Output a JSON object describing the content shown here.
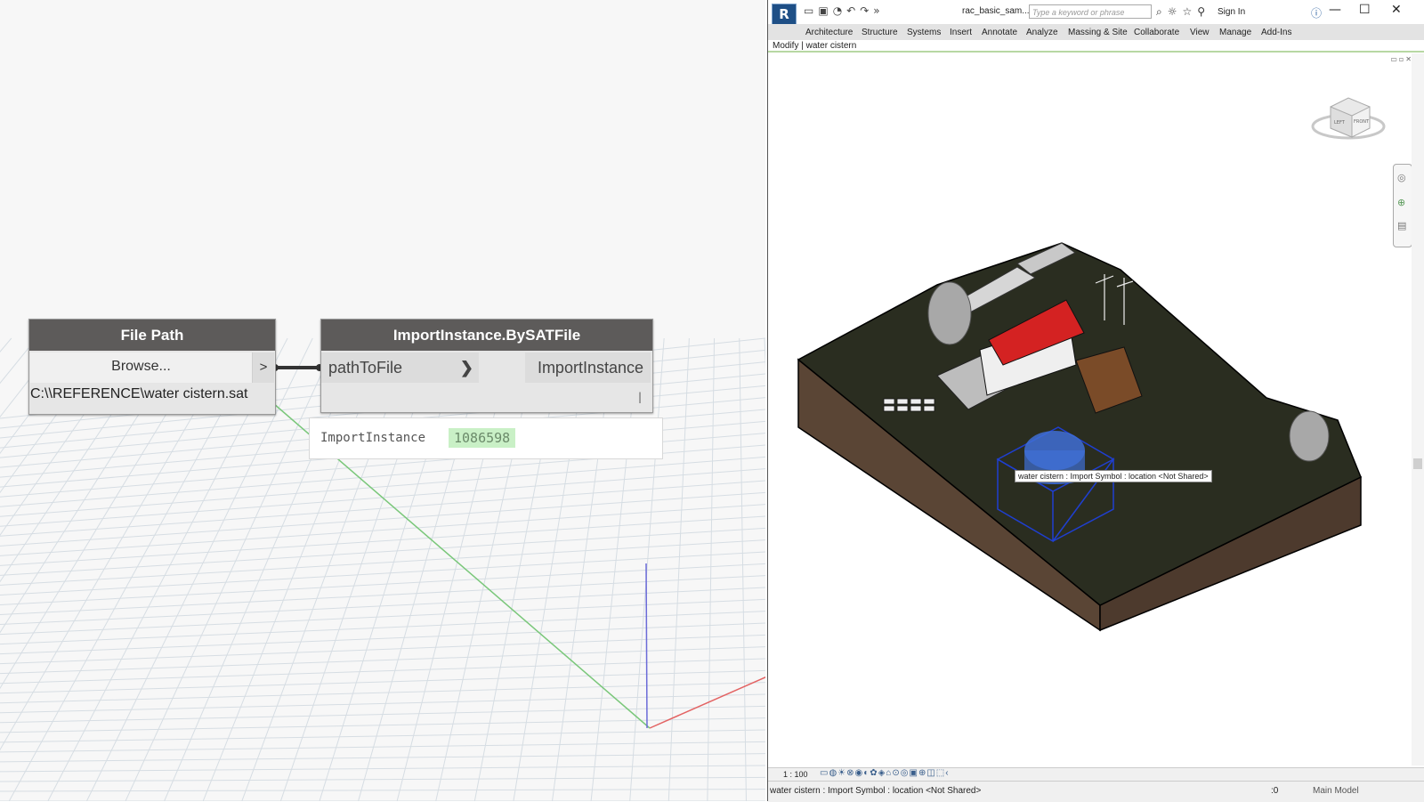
{
  "dynamo": {
    "file_path_node": {
      "title": "File Path",
      "browse_label": "Browse...",
      "out_port": ">",
      "path_value": "C:\\\\REFERENCE\\water cistern.sat"
    },
    "import_node": {
      "title": "ImportInstance.BySATFile",
      "input_label": "pathToFile",
      "input_chevron": "❯",
      "output_label": "ImportInstance",
      "lacing_mark": "|"
    },
    "preview": {
      "label": "ImportInstance",
      "value": "1086598"
    },
    "colors": {
      "node_header": "#5d5b5a",
      "preview_highlight": "#c9f0c6",
      "axis_x": "#e36363",
      "axis_y": "#7ac77a",
      "axis_z": "#6b6bd8"
    }
  },
  "revit": {
    "app_logo": "R",
    "quick_access_icons": [
      "open-icon",
      "save-icon",
      "sync-icon",
      "undo-icon",
      "redo-icon"
    ],
    "document_title": "rac_basic_sam...",
    "search_placeholder": "Type a keyword or phrase",
    "sign_in_label": "Sign In",
    "ribbon_tabs": [
      "Architecture",
      "Structure",
      "Systems",
      "Insert",
      "Annotate",
      "Analyze",
      "Massing & Site",
      "Collaborate",
      "View",
      "Manage",
      "Add-Ins"
    ],
    "context_bar": "Modify | water cistern",
    "viewcube_labels": {
      "left": "LEFT",
      "front": "FRONT"
    },
    "tooltip": "water cistern : Import Symbol : location <Not Shared>",
    "view_scale": "1 : 100",
    "status_text": "water cistern : Import Symbol : location <Not Shared>",
    "status_right_num": ":0",
    "workset": "Main Model",
    "colors": {
      "roof": "#d42222",
      "terrain_top": "#2a2d20",
      "terrain_side": "#5a4535",
      "selection": "#1f3fd0",
      "cistern": "#3f6fd6"
    }
  }
}
